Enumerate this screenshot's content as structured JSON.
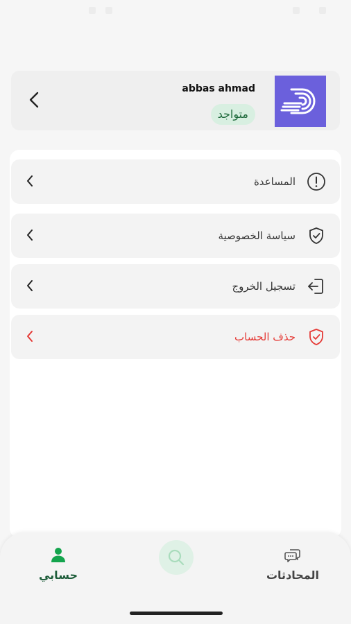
{
  "profile": {
    "name": "abbas ahmad",
    "status": "متواجد"
  },
  "menu": {
    "items": [
      {
        "label": "المساعدة",
        "icon": "info-icon"
      },
      {
        "label": "سياسة الخصوصية",
        "icon": "shield-check-icon"
      },
      {
        "label": "تسجيل الخروج",
        "icon": "logout-icon"
      },
      {
        "label": "حذف الحساب",
        "icon": "shield-check-icon"
      }
    ]
  },
  "nav": {
    "profile_label": "حسابي",
    "chats_label": "المحادثات"
  },
  "colors": {
    "accent": "#1e5d3a",
    "danger": "#e53935",
    "brand": "#6b60dc",
    "badge": "#d8efe1"
  }
}
